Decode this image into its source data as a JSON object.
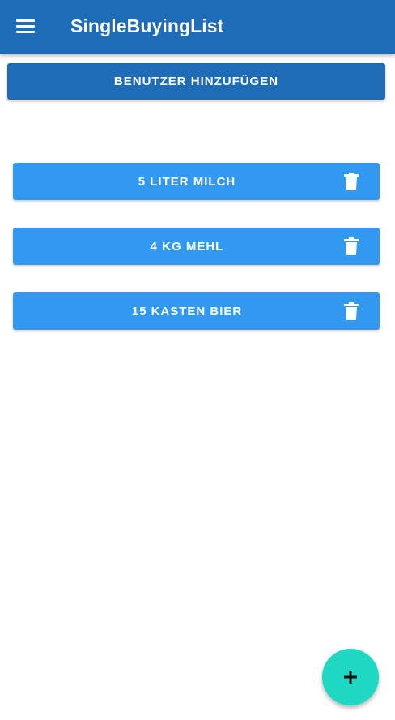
{
  "appbar": {
    "title": "SingleBuyingList",
    "menu_icon": "menu-icon"
  },
  "add_user_button": {
    "label": "BENUTZER HINZUFÜGEN"
  },
  "items": [
    {
      "label": "5 LITER MILCH",
      "icon": "trash-icon"
    },
    {
      "label": "4 KG MEHL",
      "icon": "trash-icon"
    },
    {
      "label": "15 KASTEN BIER",
      "icon": "trash-icon"
    }
  ],
  "fab": {
    "icon": "plus-icon"
  },
  "colors": {
    "primary": "#1e6bb8",
    "item": "#3199ef",
    "fab": "#1fd8c3"
  }
}
